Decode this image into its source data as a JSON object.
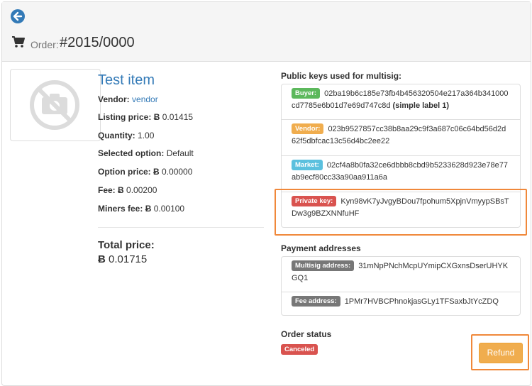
{
  "header": {
    "order_label": "Order:",
    "order_number": "#2015/0000"
  },
  "item": {
    "title": "Test item",
    "vendor_label": "Vendor:",
    "vendor_name": "vendor",
    "listing_price_label": "Listing price:",
    "listing_price": "0.01415",
    "quantity_label": "Quantity:",
    "quantity": "1.00",
    "selected_option_label": "Selected option:",
    "selected_option": "Default",
    "option_price_label": "Option price:",
    "option_price": "0.00000",
    "fee_label": "Fee:",
    "fee": "0.00200",
    "miners_fee_label": "Miners fee:",
    "miners_fee": "0.00100",
    "currency_symbol": "Ƀ",
    "total_label": "Total price:",
    "total_price": "0.01715"
  },
  "multisig": {
    "title": "Public keys used for multisig:",
    "buyer_label": "Buyer:",
    "buyer_key": "02ba19b6c185e73fb4b456320504e217a364b341000cd7785e6b01d7e69d747c8d",
    "buyer_note": "(simple label 1)",
    "vendor_label": "Vendor:",
    "vendor_key": "023b9527857cc38b8aa29c9f3a687c06c64bd56d2d62f5dbfcac13c56d4bc2ee22",
    "market_label": "Market:",
    "market_key": "02cf4a8b0fa32ce6dbbb8cbd9b5233628d923e78e77ab9ecf80cc33a90aa911a6a",
    "private_label": "Private key:",
    "private_key": "Kyn98vK7yJvgyBDou7fpohum5XpjnVmyypSBsTDw3g9BZXNNfuHF"
  },
  "payment": {
    "title": "Payment addresses",
    "multisig_label": "Multisig address:",
    "multisig_address": "31mNpPNchMcpUYmipCXGxnsDserUHYKGQ1",
    "fee_label": "Fee address:",
    "fee_address": "1PMr7HVBCPhnokjasGLy1TFSaxbJtYcZDQ"
  },
  "status": {
    "title": "Order status",
    "badge": "Canceled",
    "refund_button": "Refund"
  },
  "colors": {
    "primary": "#337ab7",
    "success": "#5cb85c",
    "warning": "#f0ad4e",
    "info": "#5bc0de",
    "danger": "#d9534f",
    "highlight": "#f0883a"
  },
  "icons": {
    "back": "arrow-left-circle-icon",
    "cart": "shopping-cart-icon",
    "no_image": "no-camera-icon"
  }
}
